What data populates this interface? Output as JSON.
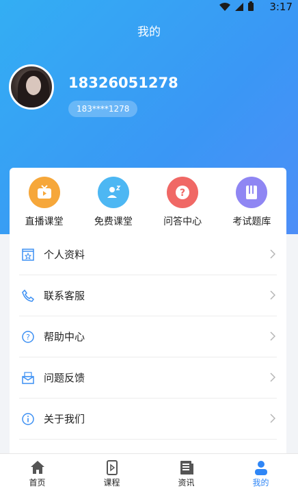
{
  "status_bar": {
    "time": "3:17"
  },
  "header": {
    "title": "我的"
  },
  "profile": {
    "phone": "18326051278",
    "masked_phone": "183****1278"
  },
  "quick_actions": [
    {
      "label": "直播课堂",
      "icon": "tv-icon"
    },
    {
      "label": "免费课堂",
      "icon": "free-class-icon"
    },
    {
      "label": "问答中心",
      "icon": "question-icon"
    },
    {
      "label": "考试题库",
      "icon": "book-icon"
    }
  ],
  "menu": [
    {
      "label": "个人资料",
      "icon": "profile-card-icon"
    },
    {
      "label": "联系客服",
      "icon": "phone-icon"
    },
    {
      "label": "帮助中心",
      "icon": "help-icon"
    },
    {
      "label": "问题反馈",
      "icon": "feedback-icon"
    },
    {
      "label": "关于我们",
      "icon": "info-icon"
    }
  ],
  "tabs": [
    {
      "label": "首页",
      "icon": "home-icon"
    },
    {
      "label": "课程",
      "icon": "course-icon"
    },
    {
      "label": "资讯",
      "icon": "news-icon"
    },
    {
      "label": "我的",
      "icon": "user-icon",
      "active": true
    }
  ],
  "colors": {
    "accent": "#2f86f6",
    "hero_start": "#33aef3",
    "hero_end": "#4d8ef7"
  }
}
